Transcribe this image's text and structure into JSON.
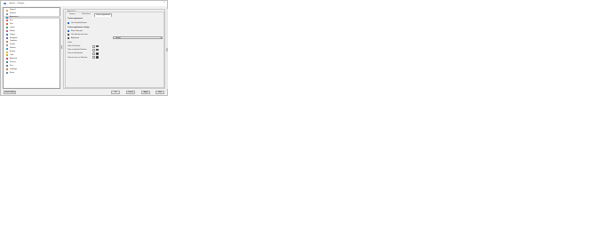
{
  "window": {
    "title": "Options — Settings"
  },
  "sidebar": {
    "items": [
      {
        "label": "General",
        "color": "#e0a030",
        "selected": false
      },
      {
        "label": "Interface",
        "color": "#7a8fb0",
        "selected": false
      },
      {
        "label": "Appearance",
        "color": "#3a7bd5",
        "selected": true
      },
      {
        "label": "Sort",
        "color": "#e05050",
        "selected": false
      },
      {
        "label": "Rule",
        "color": "#d06030",
        "selected": false
      },
      {
        "label": "Layers",
        "color": "#3aa050",
        "selected": false
      },
      {
        "label": "Editing",
        "color": "#c05080",
        "selected": false
      },
      {
        "label": "Display",
        "color": "#4070c0",
        "selected": false
      },
      {
        "label": "Navigation",
        "color": "#7050b0",
        "selected": false
      },
      {
        "label": "Templates",
        "color": "#c08030",
        "selected": false
      },
      {
        "label": "Profiles",
        "color": "#909090",
        "selected": false
      },
      {
        "label": "Network",
        "color": "#3a90c0",
        "selected": false
      },
      {
        "label": "Backup",
        "color": "#e0b030",
        "selected": false
      },
      {
        "label": "Tools",
        "color": "#d0a020",
        "selected": false
      },
      {
        "label": "Advanced",
        "color": "#d04040",
        "selected": false
      },
      {
        "label": "Security",
        "color": "#3a70b0",
        "selected": false
      },
      {
        "label": "Print",
        "color": "#707070",
        "selected": false
      },
      {
        "label": "Language",
        "color": "#d07030",
        "selected": false
      },
      {
        "label": "Extras",
        "color": "#6080a0",
        "selected": false
      }
    ]
  },
  "panel": {
    "group_title": "Appearance",
    "tabs": [
      "General",
      "Color theme",
      "Custom appearance"
    ],
    "section_heading": "Custom appearance",
    "checkbox_1": "Use the default theme",
    "subheading": "Custom appearance settings",
    "checkbox_2": "Show color grid",
    "checkbox_3": "Use alternate row color",
    "checkbox_4": "Adjustment",
    "combo_value": "Default",
    "colors_title": "Colors",
    "color_rows": [
      {
        "label": "Color of Text lines",
        "color": "#000000"
      },
      {
        "label": "Color of selected Text lines",
        "color": "#000000"
      },
      {
        "label": "Color of selection line",
        "color": "#000000"
      },
      {
        "label": "Color of cursor on Text lines",
        "color": "#000000"
      }
    ]
  },
  "footer": {
    "reset_label": "Reset Default",
    "ok_label": "OK",
    "cancel_label": "Cancel",
    "apply_label": "Apply",
    "help_label": "Help"
  }
}
